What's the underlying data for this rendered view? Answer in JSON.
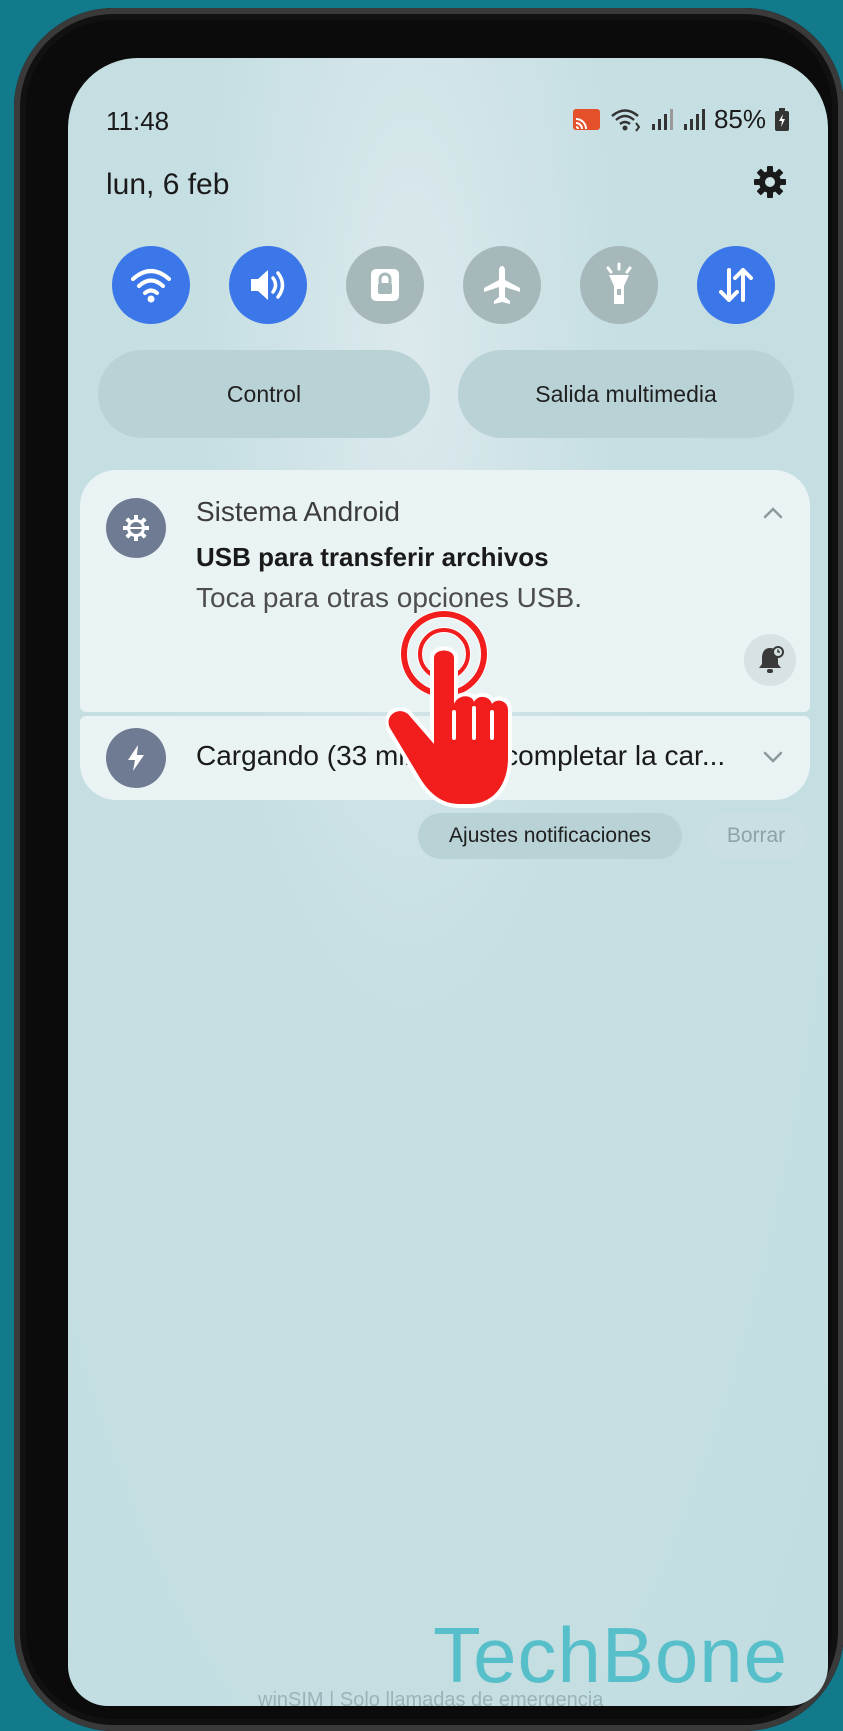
{
  "status_bar": {
    "time": "11:48",
    "battery": "85%"
  },
  "header": {
    "date": "lun, 6 feb"
  },
  "quick_settings": [
    {
      "name": "wifi",
      "state": "on"
    },
    {
      "name": "sound",
      "state": "on"
    },
    {
      "name": "rotation-lock",
      "state": "off"
    },
    {
      "name": "airplane",
      "state": "off"
    },
    {
      "name": "flashlight",
      "state": "off"
    },
    {
      "name": "mobile-data",
      "state": "on"
    }
  ],
  "shortcuts": {
    "control": "Control",
    "media_output": "Salida multimedia"
  },
  "notifications": [
    {
      "app": "Sistema Android",
      "title": "USB para transferir archivos",
      "body": "Toca para otras opciones USB."
    },
    {
      "text": "Cargando (33 min hasta completar la car..."
    }
  ],
  "actions": {
    "settings": "Ajustes notificaciones",
    "clear": "Borrar"
  },
  "footer": {
    "carrier": "winSIM | Solo llamadas de emergencia",
    "watermark": "TechBone"
  },
  "colors": {
    "accent": "#3b77e8",
    "background": "#c2dde1",
    "frame": "#137a8c",
    "tap_indicator": "#f21d1d"
  }
}
